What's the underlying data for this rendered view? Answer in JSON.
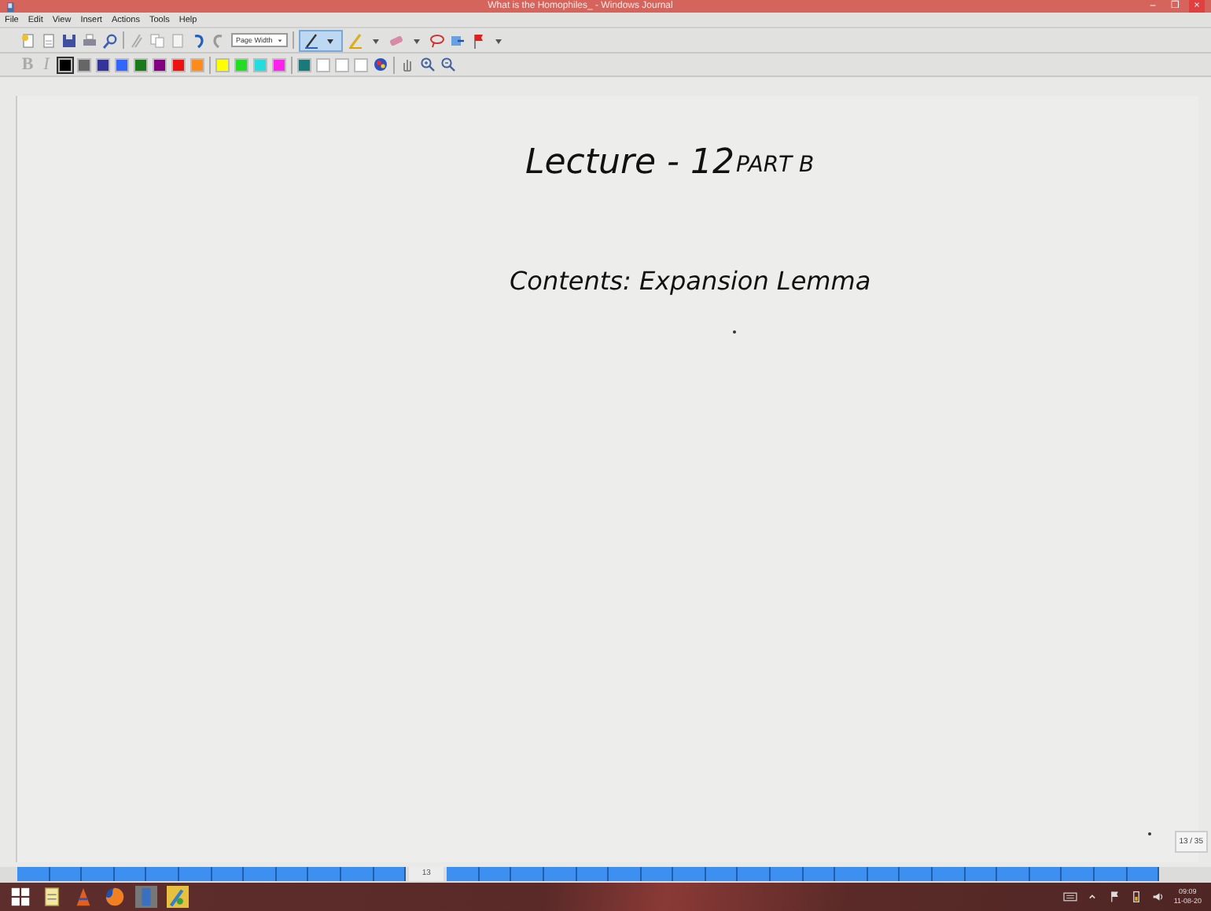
{
  "window": {
    "title": "What is the Homophiles_ - Windows Journal",
    "controls": [
      "–",
      "❐",
      "×"
    ]
  },
  "menu": [
    "File",
    "Edit",
    "View",
    "Insert",
    "Actions",
    "Tools",
    "Help"
  ],
  "toolbar": {
    "zoom_select": {
      "value": "Page Width"
    }
  },
  "format_bar": {
    "bold": "B",
    "italic": "I",
    "pen_colors": [
      {
        "color": "#000000",
        "selected": true
      },
      {
        "color": "#666666",
        "selected": false
      },
      {
        "color": "#333399",
        "selected": false
      },
      {
        "color": "#3366ff",
        "selected": false
      },
      {
        "color": "#1a7a1a",
        "selected": false
      },
      {
        "color": "#800080",
        "selected": false
      },
      {
        "color": "#ee1111",
        "selected": false
      },
      {
        "color": "#ff8c1a",
        "selected": false
      },
      {
        "color": "#ffff00",
        "selected": false
      },
      {
        "color": "#22dd22",
        "selected": false
      },
      {
        "color": "#22dddd",
        "selected": false
      },
      {
        "color": "#ff22ee",
        "selected": false
      },
      {
        "color": "#1a7a7a",
        "selected": false
      },
      {
        "color": "#ffffff",
        "selected": false
      },
      {
        "color": "#ffffff",
        "selected": false
      },
      {
        "color": "#ffffff",
        "selected": false
      }
    ]
  },
  "note": {
    "ink": [
      {
        "kind": "heading",
        "text": "Lecture - 12"
      },
      {
        "kind": "subheading",
        "text": "PART B"
      },
      {
        "kind": "line",
        "text": "Contents: Expansion Lemma"
      }
    ],
    "page_indicator": "13 / 35"
  },
  "pages": [
    {
      "selected": false
    },
    {
      "selected": false
    },
    {
      "selected": false
    },
    {
      "selected": false
    },
    {
      "selected": false
    },
    {
      "selected": false
    },
    {
      "selected": false
    },
    {
      "selected": false
    },
    {
      "selected": false
    },
    {
      "selected": false
    },
    {
      "selected": false
    },
    {
      "selected": false
    },
    {
      "selected": true,
      "label": "13"
    },
    {
      "selected": false
    },
    {
      "selected": false
    },
    {
      "selected": false
    },
    {
      "selected": false
    },
    {
      "selected": false
    },
    {
      "selected": false
    },
    {
      "selected": false
    },
    {
      "selected": false
    },
    {
      "selected": false
    },
    {
      "selected": false
    },
    {
      "selected": false
    },
    {
      "selected": false
    },
    {
      "selected": false
    },
    {
      "selected": false
    },
    {
      "selected": false
    },
    {
      "selected": false
    },
    {
      "selected": false
    },
    {
      "selected": false
    },
    {
      "selected": false
    },
    {
      "selected": false
    },
    {
      "selected": false
    },
    {
      "selected": false
    }
  ],
  "taskbar": {
    "time": "09:09",
    "date": "11-08-20"
  }
}
